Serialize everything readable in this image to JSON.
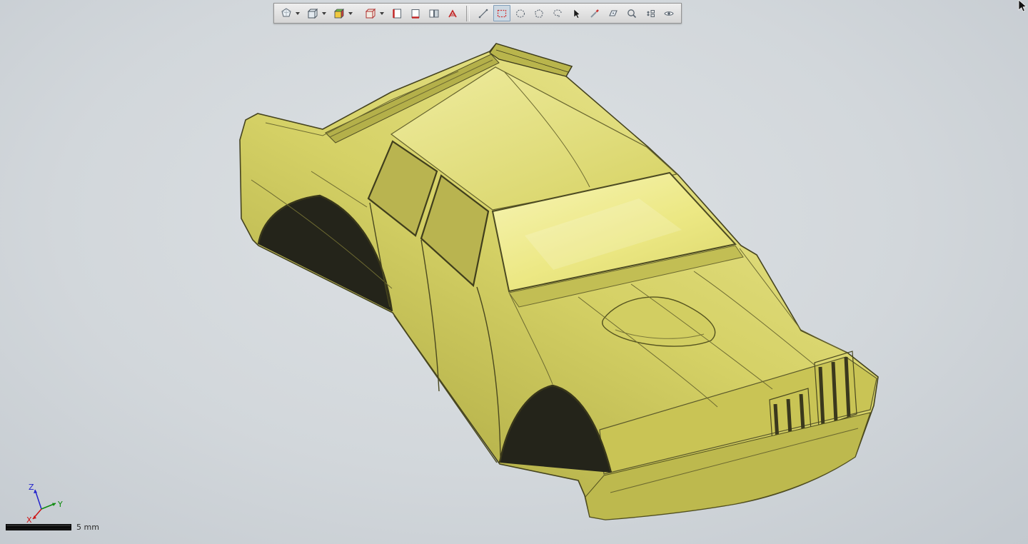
{
  "viewport": {
    "background_center": "#dde1e4",
    "background_edge": "#c3c9cf",
    "model": {
      "name": "yellow-car-body-shell",
      "base_color": "#d5d166",
      "highlight_color": "#f6f3b2",
      "shadow_color": "#a9a53f",
      "edge_color": "#45431f"
    }
  },
  "toolbar": {
    "groups": [
      {
        "name": "display-style",
        "icons": [
          "shaded-view",
          "wireframe-view",
          "rendered-view",
          "section-box",
          "section-plane-front",
          "section-plane-bottom",
          "split-section",
          "section-cap"
        ]
      },
      {
        "name": "selection-tools",
        "icons": [
          "line-select",
          "rectangle-select",
          "circle-select",
          "polygon-select",
          "lasso-select",
          "pick-cursor",
          "paint-select",
          "face-select",
          "zoom",
          "pan-vertical",
          "visibility"
        ]
      }
    ],
    "active_tool": "rectangle-select"
  },
  "axis_triad": {
    "z": {
      "label": "Z",
      "color": "#2222cc"
    },
    "y": {
      "label": "Y",
      "color": "#0d8a0d"
    },
    "x": {
      "label": "X",
      "color": "#cc1414"
    }
  },
  "scale_bar": {
    "label": "5 mm"
  }
}
